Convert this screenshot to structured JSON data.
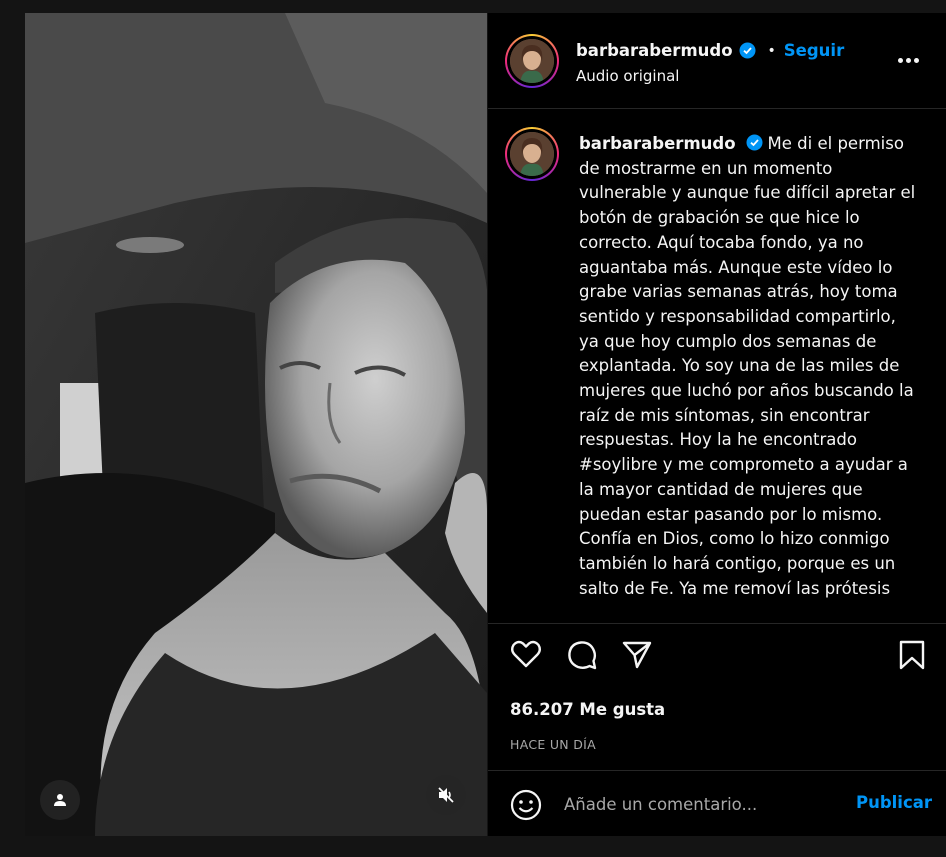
{
  "post": {
    "username": "barbarabermudo",
    "follow_label": "Seguir",
    "separator": "•",
    "audio_label": "Audio original",
    "caption": "Me di el permiso de mostrarme en un momento vulnerable y aunque fue difícil apretar el botón de grabación se que hice lo correcto. Aquí tocaba fondo, ya no aguantaba más. Aunque este vídeo lo grabe varias semanas atrás, hoy toma sentido y responsabilidad compartirlo, ya que hoy cumplo dos semanas de explantada. Yo soy una de las miles de mujeres que luchó por años buscando la raíz de mis síntomas, sin encontrar respuestas. Hoy la he encontrado #soylibre y me comprometo a ayudar a la mayor cantidad de mujeres que puedan estar pasando por lo mismo. Confía en Dios, como lo hizo conmigo también lo hará contigo, porque es un salto de Fe. Ya me removí las prótesis",
    "likes": "86.207 Me gusta",
    "time": "HACE UN DÍA"
  },
  "comment": {
    "placeholder": "Añade un comentario...",
    "publish_label": "Publicar"
  },
  "icons": {
    "verified": "verified-badge-icon",
    "more": "more-options-icon",
    "like": "heart-icon",
    "comment": "comment-bubble-icon",
    "share": "paper-plane-icon",
    "save": "bookmark-icon",
    "emoji": "emoji-smile-icon",
    "tag": "person-icon",
    "mute": "speaker-muted-icon"
  },
  "colors": {
    "accent": "#0095f6",
    "panel_bg": "#000000",
    "page_bg": "#141414",
    "secondary_text": "#a8a8a8"
  }
}
